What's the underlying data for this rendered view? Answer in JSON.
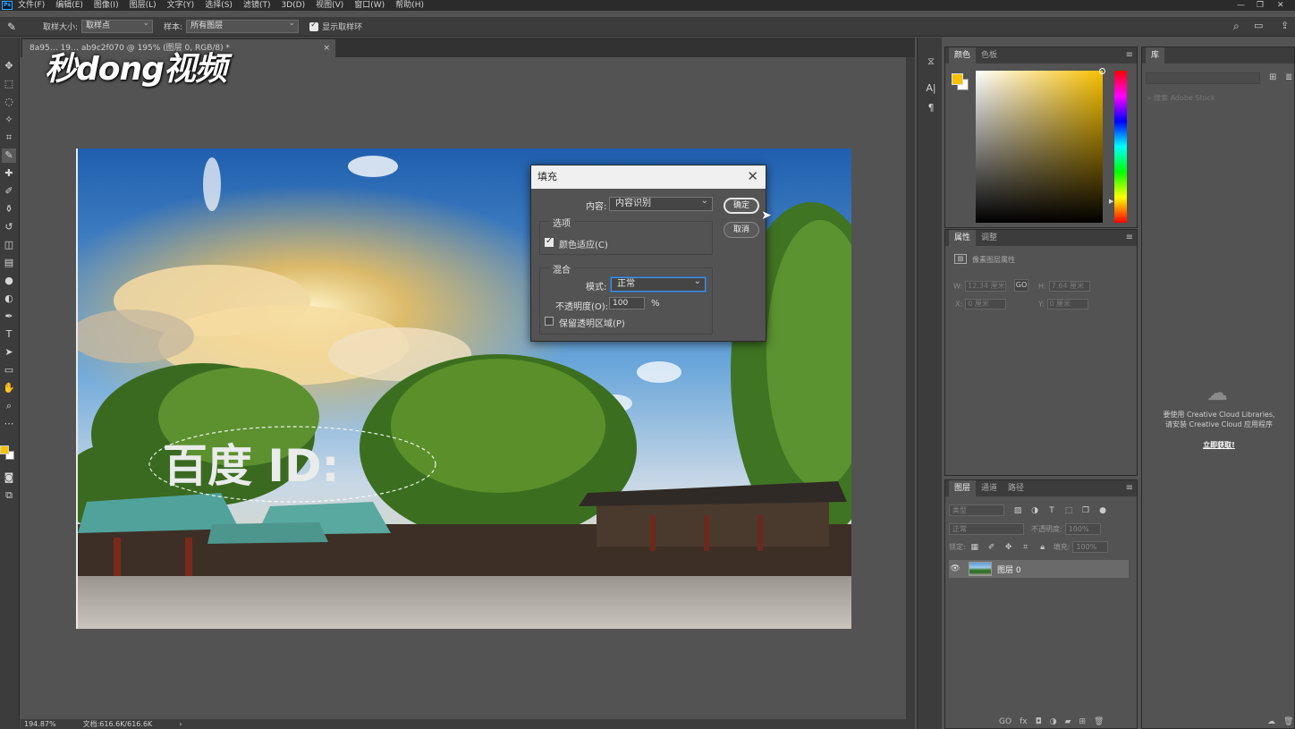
{
  "menubar": {
    "logo": "Ps",
    "items": [
      "文件(F)",
      "编辑(E)",
      "图像(I)",
      "图层(L)",
      "文字(Y)",
      "选择(S)",
      "滤镜(T)",
      "3D(D)",
      "视图(V)",
      "窗口(W)",
      "帮助(H)"
    ],
    "min": "—",
    "max": "❐",
    "close": "✕"
  },
  "options": {
    "sample_size_label": "取样大小:",
    "sample_size_value": "取样点",
    "sample_label": "样本:",
    "sample_value": "所有图层",
    "show_ring_label": "显示取样环"
  },
  "document": {
    "tab_title": "8a95… 19… ab9c2f070 @ 195% (图层 0, RGB/8) *",
    "tab_close": "×",
    "watermark": "秒dong视频",
    "image_text": "百度 ID:"
  },
  "status": {
    "zoom": "194.87%",
    "doc": "文档:616.6K/616.6K",
    "arrow": "›"
  },
  "color_panel": {
    "tabs": [
      "颜色",
      "色板"
    ],
    "fg_color": "#f7c200",
    "bg_color": "#ffffff"
  },
  "props_panel": {
    "tabs": [
      "属性",
      "调整"
    ],
    "heading": "像素图层属性",
    "w_label": "W:",
    "w_value": "12.34 厘米",
    "h_label": "H:",
    "h_value": "7.64 厘米",
    "x_label": "X:",
    "x_value": "0 厘米",
    "y_label": "Y:",
    "y_value": "0 厘米",
    "link": "GO"
  },
  "layers_panel": {
    "tabs": [
      "图层",
      "通道",
      "路径"
    ],
    "filter_label": "类型",
    "blend_mode": "正常",
    "opacity_label": "不透明度:",
    "opacity_value": "100%",
    "lock_label": "锁定:",
    "fill_label": "填充:",
    "fill_value": "100%",
    "layer_name": "图层 0",
    "footer_icons": [
      "GO",
      "fx"
    ]
  },
  "library_panel": {
    "tab": "库",
    "search_placeholder": "搜索 Adobe Stock",
    "msg_line1": "要使用 Creative Cloud Libraries,",
    "msg_line2": "请安装 Creative Cloud 应用程序",
    "install_link": "立即获取!"
  },
  "fill_dialog": {
    "title": "填充",
    "content_label": "内容:",
    "content_value": "内容识别",
    "ok_label": "确定",
    "cancel_label": "取消",
    "options_title": "选项",
    "color_adapt_label": "颜色适应(C)",
    "color_adapt_checked": true,
    "blend_title": "混合",
    "mode_label": "模式:",
    "mode_value": "正常",
    "opacity_label": "不透明度(O):",
    "opacity_value": "100",
    "opacity_unit": "%",
    "preserve_label": "保留透明区域(P)",
    "preserve_checked": false
  }
}
